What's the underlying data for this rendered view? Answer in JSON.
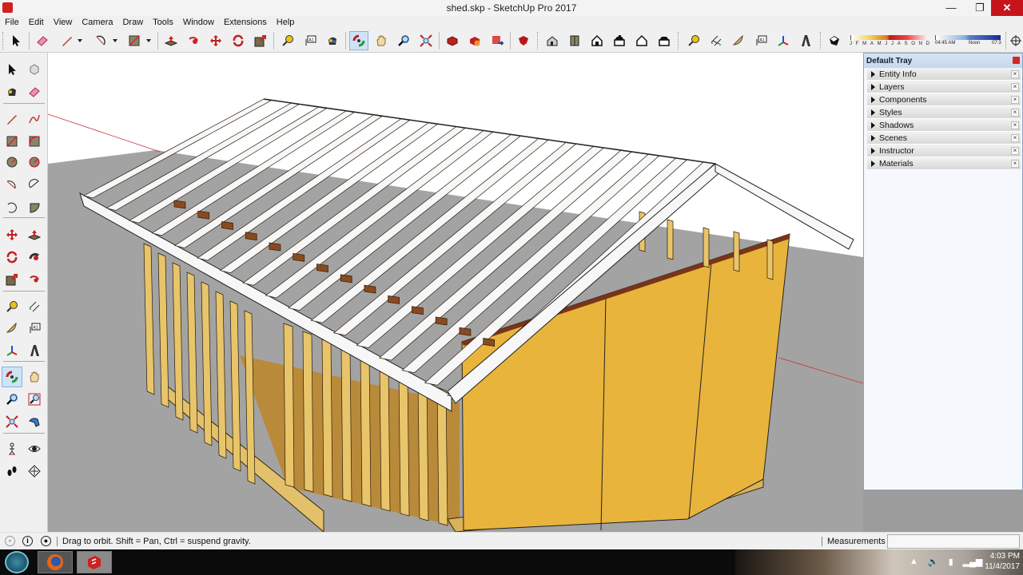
{
  "window": {
    "title": "shed.skp - SketchUp Pro 2017",
    "minimize": "—",
    "maximize": "❐",
    "close": "✕"
  },
  "menu": [
    "File",
    "Edit",
    "View",
    "Camera",
    "Draw",
    "Tools",
    "Window",
    "Extensions",
    "Help"
  ],
  "toolbar": {
    "groups": [
      {
        "name": "principal",
        "tools": [
          "select-icon",
          "eraser-icon",
          "pencil-line-icon",
          "arc-icon",
          "rectangle-icon"
        ]
      },
      {
        "name": "edit",
        "tools": [
          "push-pull-icon",
          "follow-me-icon",
          "move-icon",
          "rotate-icon",
          "scale-icon"
        ]
      },
      {
        "name": "construction",
        "tools": [
          "tape-measure-icon",
          "text-icon",
          "paint-bucket-icon"
        ]
      },
      {
        "name": "camera",
        "tools": [
          "orbit-icon",
          "pan-icon",
          "zoom-icon",
          "zoom-extents-icon"
        ]
      },
      {
        "name": "warehouse",
        "tools": [
          "3d-warehouse-icon",
          "share-component-icon",
          "upload-icon",
          "extension-warehouse-icon"
        ]
      },
      {
        "name": "views",
        "tools": [
          "iso-view-icon",
          "top-view-icon",
          "front-view-icon",
          "right-view-icon",
          "back-view-icon",
          "left-view-icon"
        ]
      },
      {
        "name": "construction2",
        "tools": [
          "tape-measure-icon",
          "dimension-icon",
          "protractor-icon",
          "text-icon",
          "axes-icon",
          "3d-text-icon"
        ]
      },
      {
        "name": "shadows",
        "tools": [
          "shadow-toggle-icon"
        ]
      }
    ],
    "active_tool": "orbit-icon",
    "shadow_settings": {
      "months": [
        "J",
        "F",
        "M",
        "A",
        "M",
        "J",
        "J",
        "A",
        "S",
        "O",
        "N",
        "D"
      ],
      "time_start": "04:45 AM",
      "time_mid": "Noon",
      "time_end": "07:3"
    }
  },
  "left_toolbar": {
    "tools": [
      "select-icon",
      "make-component-icon",
      "paint-bucket-icon",
      "eraser-icon",
      "line-icon",
      "freehand-icon",
      "rectangle-icon",
      "rotated-rectangle-icon",
      "circle-icon",
      "polygon-icon",
      "arc-icon",
      "two-point-arc-icon",
      "three-point-arc-icon",
      "pie-icon",
      "move-icon",
      "push-pull-icon",
      "rotate-icon",
      "follow-me-icon",
      "scale-icon",
      "offset-icon",
      "tape-measure-icon",
      "dimension-icon",
      "protractor-icon",
      "text-icon",
      "axes-icon",
      "3d-text-icon",
      "orbit-icon",
      "pan-icon",
      "zoom-icon",
      "zoom-window-icon",
      "zoom-extents-icon",
      "previous-view-icon",
      "position-camera-icon",
      "look-around-icon",
      "walk-icon",
      "section-plane-icon"
    ],
    "active_tool": "orbit-icon"
  },
  "tray": {
    "title": "Default Tray",
    "panels": [
      "Entity Info",
      "Layers",
      "Components",
      "Styles",
      "Shadows",
      "Scenes",
      "Instructor",
      "Materials"
    ]
  },
  "status": {
    "hint": "Drag to orbit. Shift = Pan, Ctrl = suspend gravity.",
    "measurements_label": "Measurements",
    "measurements_value": ""
  },
  "taskbar": {
    "apps": [
      "Firefox",
      "SketchUp"
    ],
    "time": "4:03 PM",
    "date": "11/4/2017"
  },
  "scene": {
    "description": "3D model of a shed frame with gable roof rafters, wall studs and OSB sheathing",
    "colors": {
      "ground": "#a3a3a3",
      "sky": "#ffffff",
      "rafter": "#f7f7f7",
      "stud": "#e8c56a",
      "osb": "#e8b43c",
      "floor": "#b98a3a",
      "plate": "#7a3418",
      "axis_red": "#c83030"
    }
  }
}
